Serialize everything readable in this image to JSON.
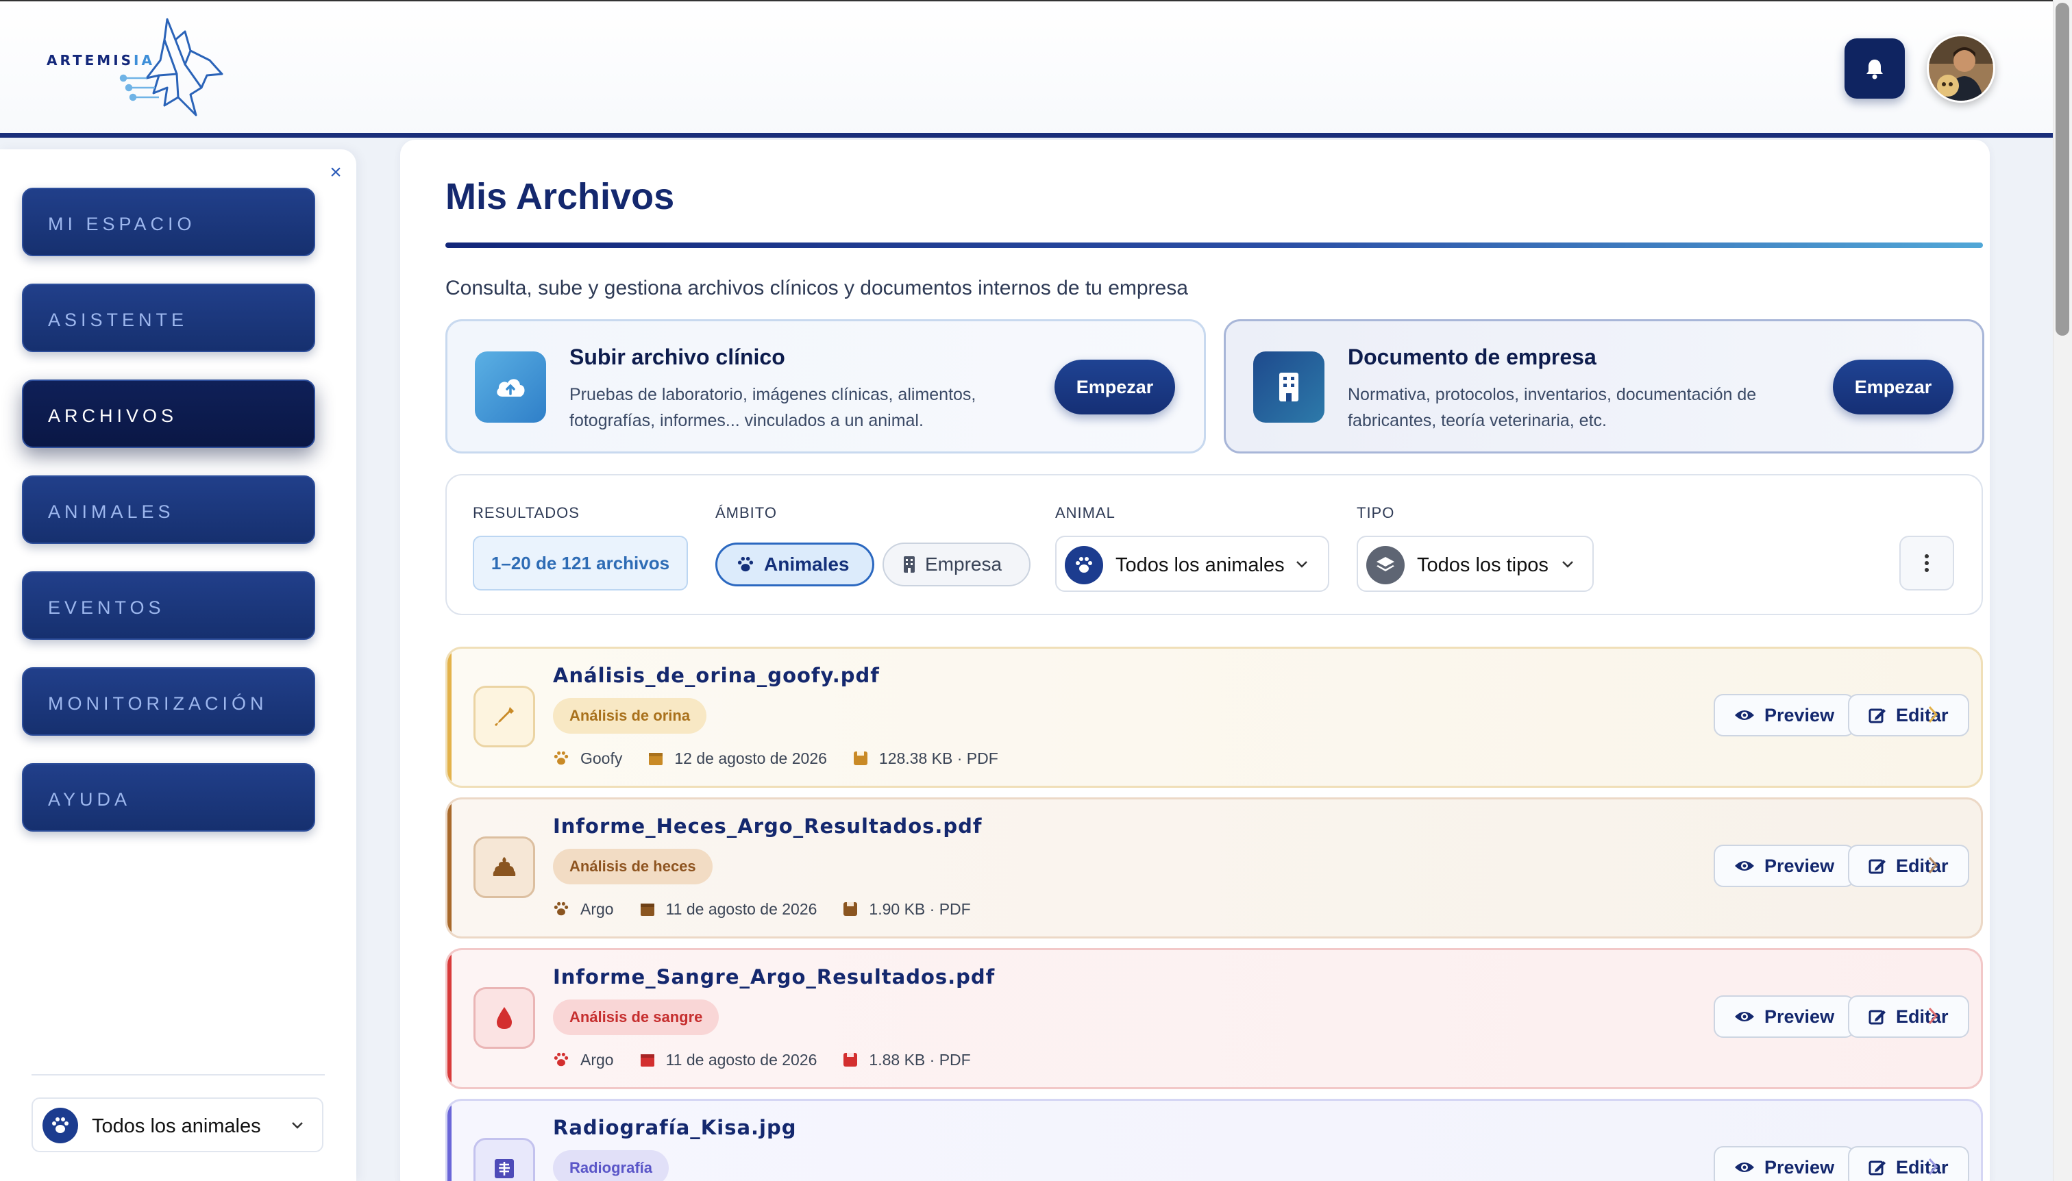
{
  "brand": {
    "name_main": "ARTEMIS",
    "name_accent": "IA"
  },
  "header": {
    "bell_icon": "bell-icon",
    "avatar_alt": "Usuario"
  },
  "sidebar": {
    "items": [
      {
        "label": "MI ESPACIO",
        "active": false
      },
      {
        "label": "ASISTENTE",
        "active": false
      },
      {
        "label": "ARCHIVOS",
        "active": true
      },
      {
        "label": "ANIMALES",
        "active": false
      },
      {
        "label": "EVENTOS",
        "active": false
      },
      {
        "label": "MONITORIZACIÓN",
        "active": false
      },
      {
        "label": "AYUDA",
        "active": false
      }
    ],
    "animal_selector": "Todos los animales",
    "close_symbol": "×"
  },
  "main": {
    "title": "Mis Archivos",
    "subtitle": "Consulta, sube y gestiona archivos clínicos y documentos internos de tu empresa",
    "cards": [
      {
        "title": "Subir archivo clínico",
        "description": "Pruebas de laboratorio, imágenes clínicas, alimentos, fotografías, informes... vinculados a un animal.",
        "button": "Empezar",
        "icon": "cloud-upload-icon"
      },
      {
        "title": "Documento de empresa",
        "description": "Normativa, protocolos, inventarios, documentación de fabricantes, teoría veterinaria, etc.",
        "button": "Empezar",
        "icon": "building-icon"
      }
    ],
    "filters": {
      "results_label": "RESULTADOS",
      "results_value": "1–20 de 121 archivos",
      "scope_label": "ÁMBITO",
      "scope_options": [
        "Animales",
        "Empresa"
      ],
      "scope_selected": "Animales",
      "animal_label": "ANIMAL",
      "animal_value": "Todos los animales",
      "type_label": "TIPO",
      "type_value": "Todos los tipos"
    },
    "files": [
      {
        "name": "Análisis_de_orina_goofy.pdf",
        "category": "Análisis de orina",
        "animal": "Goofy",
        "date": "12 de agosto de 2026",
        "size": "128.38 KB · PDF",
        "icon": "pipette-icon"
      },
      {
        "name": "Informe_Heces_Argo_Resultados.pdf",
        "category": "Análisis de heces",
        "animal": "Argo",
        "date": "11 de agosto de 2026",
        "size": "1.90 KB · PDF",
        "icon": "poop-icon"
      },
      {
        "name": "Informe_Sangre_Argo_Resultados.pdf",
        "category": "Análisis de sangre",
        "animal": "Argo",
        "date": "11 de agosto de 2026",
        "size": "1.88 KB · PDF",
        "icon": "blood-drop-icon"
      },
      {
        "name": "Radiografía_Kisa.jpg",
        "category": "Radiografía",
        "icon": "xray-icon"
      }
    ],
    "row_actions": {
      "preview": "Preview",
      "edit": "Editar"
    }
  },
  "colors": {
    "primary": "#14286e",
    "accent": "#2b68c0",
    "orina": "#e3b24a",
    "heces": "#a8692b",
    "sangre": "#d83a3a",
    "radiografia": "#6a66d8"
  }
}
